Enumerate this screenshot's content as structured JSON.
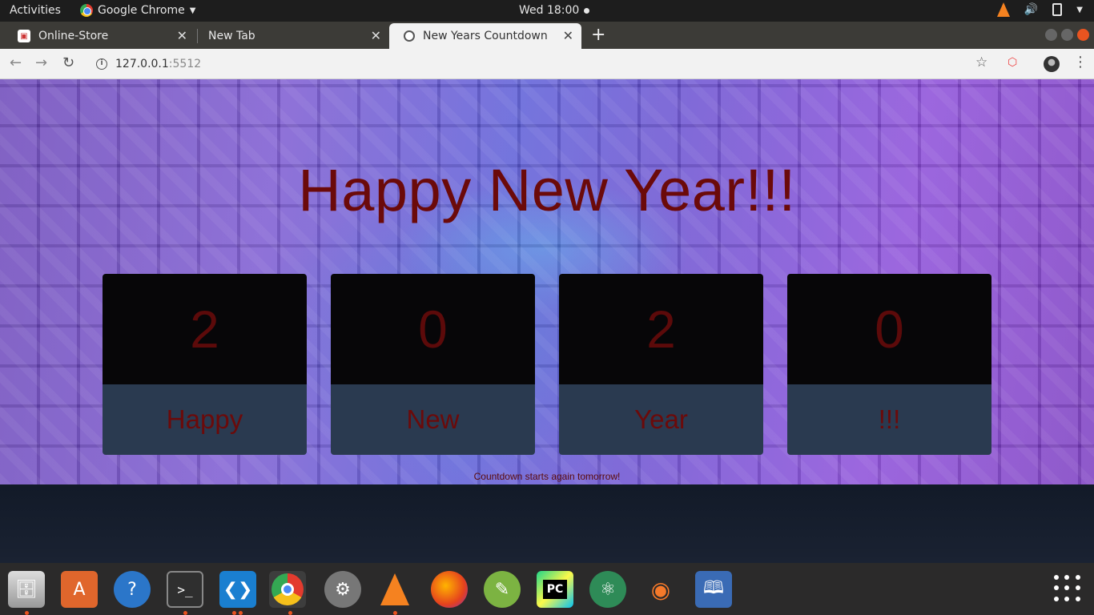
{
  "system_bar": {
    "activities": "Activities",
    "app_name": "Google Chrome",
    "clock": "Wed 18:00"
  },
  "browser": {
    "tabs": [
      {
        "label": "Online-Store"
      },
      {
        "label": "New Tab"
      },
      {
        "label": "New Years Countdown"
      }
    ],
    "url_host": "127.0.0.1",
    "url_port": ":5512"
  },
  "page": {
    "headline": "Happy New Year!!!",
    "cards": [
      {
        "digit": "2",
        "word": "Happy"
      },
      {
        "digit": "0",
        "word": "New"
      },
      {
        "digit": "2",
        "word": "Year"
      },
      {
        "digit": "0",
        "word": "!!!"
      }
    ],
    "footnote": "Countdown starts again tomorrow!"
  },
  "dock": {
    "apps": [
      "files-icon",
      "software-icon",
      "help-icon",
      "terminal-icon",
      "vscode-icon",
      "chrome-icon",
      "settings-icon",
      "vlc-icon",
      "firefox-icon",
      "android-studio-icon",
      "pycharm-icon",
      "atom-icon",
      "blender-icon",
      "notes-icon"
    ]
  },
  "colors": {
    "headline": "#6b0a0a",
    "card_top": "#070608",
    "card_bottom": "#2a3a50"
  }
}
